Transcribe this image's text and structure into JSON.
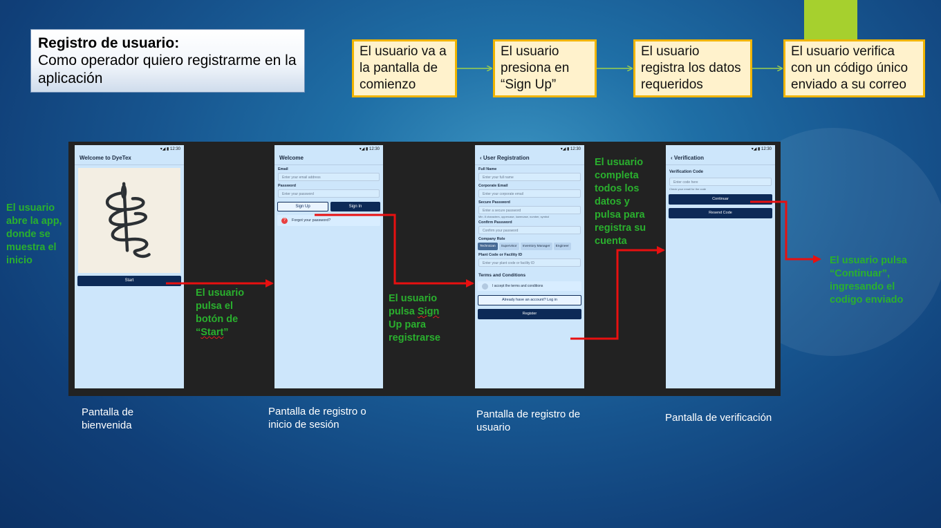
{
  "header": {
    "title": "Registro de usuario:",
    "subtitle": "Como operador quiero registrarme en la aplicación"
  },
  "flow_steps": [
    "El usuario va a la pantalla de comienzo",
    "El usuario presiona en “Sign Up”",
    "El usuario registra los datos requeridos",
    "El usuario verifica con un código único enviado a su correo"
  ],
  "status_bar": "▾◢ ▮ 12:30",
  "screens": {
    "welcome": {
      "title": "Welcome to DyeTex",
      "start_button": "Start",
      "caption": "Pantalla de bienvenida"
    },
    "login": {
      "title": "Welcome",
      "email_label": "Email",
      "email_placeholder": "Enter your email address",
      "password_label": "Password",
      "password_placeholder": "Enter your password",
      "signup_button": "Sign Up",
      "signin_button": "Sign In",
      "forgot_link": "Forgot your password?",
      "caption": "Pantalla de registro o inicio de sesión"
    },
    "registration": {
      "title": "User Registration",
      "fullname_label": "Full Name",
      "fullname_placeholder": "Enter your full name",
      "email_label": "Corporate Email",
      "email_placeholder": "Enter your corporate email",
      "password_label": "Secure Password",
      "password_placeholder": "Enter a secure password",
      "password_hint": "Min. 8 characters, uppercase, lowercase, number, symbol",
      "confirm_label": "Confirm Password",
      "confirm_placeholder": "Confirm your password",
      "role_label": "Company Role",
      "roles": [
        "Technician",
        "Supervisor",
        "Inventory Manager",
        "Engineer"
      ],
      "plant_label": "Plant Code or Facility ID",
      "plant_placeholder": "Enter your plant code or facility ID",
      "terms_title": "Terms and Conditions",
      "terms_check": "I accept the terms and conditions",
      "login_link": "Already have an account? Log in",
      "register_button": "Register",
      "caption": "Pantalla de registro de usuario"
    },
    "verification": {
      "title": "Verification",
      "code_label": "Verification Code",
      "code_placeholder": "Enter code here",
      "hint": "Check your email for the code",
      "continue_button": "Continuar",
      "resend_button": "Resend Code",
      "caption": "Pantalla de verificación"
    }
  },
  "notes": {
    "open_app": "El usuario abre la app, donde se muestra el inicio",
    "press_start_pre": "El usuario pulsa el botón de “",
    "press_start_word": "Start",
    "press_start_post": "”",
    "press_signup_pre": "El usuario pulsa ",
    "press_signup_word": "Sign",
    "press_signup_post": " Up para registrarse",
    "complete_data": "El usuario completa todos los datos y pulsa para registra su cuenta",
    "press_continue": "El usuario pulsa “Continuar”, ingresando el codigo enviado"
  },
  "colors": {
    "accent_red": "#e81010",
    "note_green": "#2ab02e",
    "flow_border": "#f0b400",
    "flow_fill": "#fff2cc",
    "app_dark_blue": "#0d2a57",
    "app_bg": "#cde6fb"
  }
}
